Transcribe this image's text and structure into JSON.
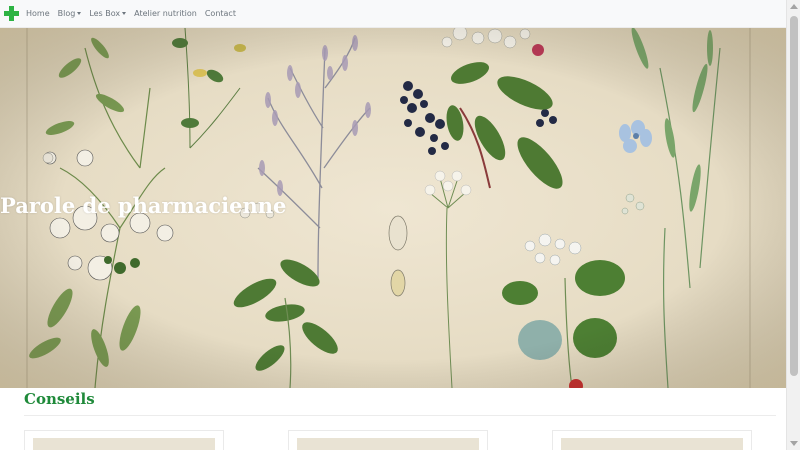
{
  "navbar": {
    "items": [
      {
        "label": "Home",
        "dropdown": false
      },
      {
        "label": "Blog",
        "dropdown": true
      },
      {
        "label": "Les Box",
        "dropdown": true
      },
      {
        "label": "Atelier nutrition",
        "dropdown": false
      },
      {
        "label": "Contact",
        "dropdown": false
      }
    ]
  },
  "hero": {
    "title": "Parole de pharmacienne"
  },
  "section": {
    "title": "Conseils"
  },
  "colors": {
    "brand_cross": "#2db343",
    "section_title": "#1f8a3a",
    "navbar_bg": "#f8f9fa",
    "nav_text": "#6c757d"
  },
  "icons": {
    "brand": "pharmacy-cross-icon"
  }
}
